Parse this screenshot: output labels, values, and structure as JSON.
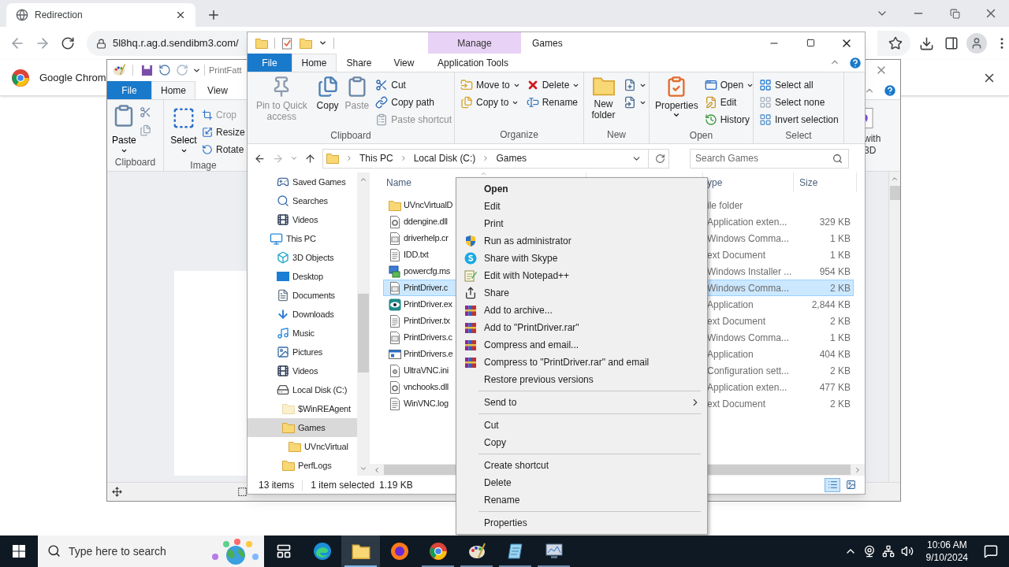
{
  "browser": {
    "tab": {
      "title": "Redirection",
      "selected": true
    },
    "url": "5l8hq.r.ag.d.sendibm3.com/",
    "infobar": "Google Chrom"
  },
  "paint": {
    "title": "PrintFatt",
    "tabs": [
      {
        "label": "File",
        "kind": "file",
        "selected": false
      },
      {
        "label": "Home",
        "kind": "tab",
        "selected": true
      },
      {
        "label": "View",
        "kind": "tab",
        "selected": false
      }
    ],
    "clipboard": {
      "label": "Clipboard",
      "paste": "Paste"
    },
    "image": {
      "label": "Image",
      "select": "Select",
      "tools": [
        {
          "label": "Crop",
          "disabled": true
        },
        {
          "label": "Resize",
          "disabled": false
        },
        {
          "label": "Rotate",
          "disabled": false
        }
      ]
    },
    "paint3d": [
      "with",
      "3D"
    ]
  },
  "explorer": {
    "title": "Games",
    "contextual_tab": "Manage",
    "tabs": [
      {
        "label": "File",
        "kind": "file",
        "selected": false
      },
      {
        "label": "Home",
        "kind": "tab",
        "selected": true
      },
      {
        "label": "Share",
        "kind": "tab",
        "selected": false
      },
      {
        "label": "View",
        "kind": "tab",
        "selected": false
      },
      {
        "label": "Application Tools",
        "kind": "contextual",
        "selected": false
      }
    ],
    "ribbon": [
      {
        "label": "Clipboard",
        "columns": [
          [
            {
              "label": "Pin to Quick access",
              "kind": "large",
              "dropdown": false,
              "disabled": true
            }
          ],
          [
            {
              "label": "Copy",
              "kind": "large",
              "dropdown": false,
              "disabled": false
            }
          ],
          [
            {
              "label": "Paste",
              "kind": "large",
              "dropdown": false,
              "disabled": true
            }
          ],
          [
            {
              "label": "Cut",
              "kind": "small",
              "dropdown": false,
              "disabled": false
            },
            {
              "label": "Copy path",
              "kind": "small",
              "dropdown": false,
              "disabled": false
            },
            {
              "label": "Paste shortcut",
              "kind": "small",
              "dropdown": false,
              "disabled": true
            }
          ]
        ]
      },
      {
        "label": "Organize",
        "columns": [
          [
            {
              "label": "Move to",
              "kind": "small",
              "dropdown": true,
              "disabled": false
            },
            {
              "label": "Copy to",
              "kind": "small",
              "dropdown": true,
              "disabled": false
            }
          ],
          [
            {
              "label": "Delete",
              "kind": "small",
              "dropdown": true,
              "disabled": false
            },
            {
              "label": "Rename",
              "kind": "small",
              "dropdown": false,
              "disabled": false
            }
          ]
        ]
      },
      {
        "label": "New",
        "columns": [
          [
            {
              "label": "New folder",
              "kind": "large",
              "dropdown": false,
              "disabled": false
            }
          ],
          [
            {
              "kind": "small",
              "dropdown": true,
              "disabled": false
            },
            {
              "kind": "small",
              "dropdown": true,
              "disabled": false
            }
          ]
        ]
      },
      {
        "label": "Open",
        "columns": [
          [
            {
              "label": "Properties",
              "kind": "large",
              "dropdown": true,
              "disabled": false
            }
          ],
          [
            {
              "label": "Open",
              "kind": "small",
              "dropdown": true,
              "disabled": false
            },
            {
              "label": "Edit",
              "kind": "small",
              "dropdown": false,
              "disabled": false
            },
            {
              "label": "History",
              "kind": "small",
              "dropdown": false,
              "disabled": false
            }
          ]
        ]
      },
      {
        "label": "Select",
        "columns": [
          [
            {
              "label": "Select all",
              "kind": "small",
              "dropdown": false,
              "disabled": false
            },
            {
              "label": "Select none",
              "kind": "small",
              "dropdown": false,
              "disabled": false
            },
            {
              "label": "Invert selection",
              "kind": "small",
              "dropdown": false,
              "disabled": false
            }
          ]
        ]
      }
    ],
    "address": [
      "This PC",
      "Local Disk (C:)",
      "Games"
    ],
    "search_placeholder": "Search Games",
    "nav": {
      "scrolled_group": [
        {
          "label": "Saved Games",
          "kind": "games",
          "selected": false
        },
        {
          "label": "Searches",
          "kind": "searches",
          "selected": false
        },
        {
          "label": "Videos",
          "kind": "videos",
          "selected": false
        }
      ],
      "tree": [
        {
          "label": "This PC",
          "kind": "computer",
          "selected": false,
          "children": [
            {
              "label": "3D Objects",
              "kind": "objects",
              "selected": false
            },
            {
              "label": "Desktop",
              "kind": "desktop",
              "selected": false
            },
            {
              "label": "Documents",
              "kind": "documents",
              "selected": false
            },
            {
              "label": "Downloads",
              "kind": "downloads",
              "selected": false
            },
            {
              "label": "Music",
              "kind": "music",
              "selected": false
            },
            {
              "label": "Pictures",
              "kind": "pictures",
              "selected": false
            },
            {
              "label": "Videos",
              "kind": "videos",
              "selected": false
            },
            {
              "label": "Local Disk (C:)",
              "kind": "drive",
              "selected": false,
              "children": [
                {
                  "label": "$WinREAgent",
                  "kind": "hidden",
                  "selected": false
                },
                {
                  "label": "Games",
                  "kind": "folder",
                  "selected": true,
                  "children": [
                    {
                      "label": "UVncVirtual",
                      "kind": "folder",
                      "selected": false
                    }
                  ]
                },
                {
                  "label": "PerfLogs",
                  "kind": "folder",
                  "selected": false
                }
              ]
            }
          ]
        }
      ]
    },
    "columns": [
      "Name",
      "ype",
      "Size"
    ],
    "files": [
      {
        "name": "UVncVirtualD",
        "type": "ile folder",
        "kind": "folder",
        "selected": false
      },
      {
        "name": "ddengine.dll",
        "type": "Application exten...",
        "size": "329 KB",
        "kind": "dll",
        "selected": false
      },
      {
        "name": "driverhelp.cr",
        "type": "Windows Comma...",
        "size": "1 KB",
        "kind": "cmd",
        "selected": false
      },
      {
        "name": "IDD.txt",
        "type": "ext Document",
        "size": "1 KB",
        "kind": "txt",
        "selected": false
      },
      {
        "name": "powercfg.ms",
        "type": "Windows Installer ...",
        "size": "954 KB",
        "kind": "msi",
        "selected": false
      },
      {
        "name": "PrintDriver.c",
        "type": "Windows Comma...",
        "size": "2 KB",
        "kind": "cmd",
        "selected": true
      },
      {
        "name": "PrintDriver.ex",
        "type": "Application",
        "size": "2,844 KB",
        "kind": "app",
        "selected": false
      },
      {
        "name": "PrintDriver.tx",
        "type": "ext Document",
        "size": "2 KB",
        "kind": "txt",
        "selected": false
      },
      {
        "name": "PrintDrivers.c",
        "type": "Windows Comma...",
        "size": "1 KB",
        "kind": "cmd",
        "selected": false
      },
      {
        "name": "PrintDrivers.e",
        "type": "Application",
        "size": "404 KB",
        "kind": "exe",
        "selected": false
      },
      {
        "name": "UltraVNC.ini",
        "type": "Configuration sett...",
        "size": "2 KB",
        "kind": "ini",
        "selected": false
      },
      {
        "name": "vnchooks.dll",
        "type": "Application exten...",
        "size": "477 KB",
        "kind": "dll",
        "selected": false
      },
      {
        "name": "WinVNC.log",
        "type": "ext Document",
        "size": "2 KB",
        "kind": "txt",
        "selected": false
      }
    ],
    "status": {
      "count": "13 items",
      "selection": "1 item selected",
      "size": "1.19 KB"
    }
  },
  "context_menu": [
    {
      "kind": "item",
      "label": "Open",
      "default": true
    },
    {
      "kind": "item",
      "label": "Edit",
      "default": false
    },
    {
      "kind": "item",
      "label": "Print",
      "default": false
    },
    {
      "kind": "item",
      "label": "Run as administrator",
      "default": false
    },
    {
      "kind": "item",
      "label": "Share with Skype",
      "default": false
    },
    {
      "kind": "item",
      "label": "Edit with Notepad++",
      "default": false
    },
    {
      "kind": "item",
      "label": "Share",
      "default": false
    },
    {
      "kind": "item",
      "label": "Add to archive...",
      "default": false
    },
    {
      "kind": "item",
      "label": "Add to \"PrintDriver.rar\"",
      "default": false
    },
    {
      "kind": "item",
      "label": "Compress and email...",
      "default": false
    },
    {
      "kind": "item",
      "label": "Compress to \"PrintDriver.rar\" and email",
      "default": false
    },
    {
      "kind": "item",
      "label": "Restore previous versions",
      "default": false
    },
    {
      "kind": "separator"
    },
    {
      "kind": "submenu",
      "label": "Send to",
      "default": false
    },
    {
      "kind": "separator"
    },
    {
      "kind": "item",
      "label": "Cut",
      "default": false
    },
    {
      "kind": "item",
      "label": "Copy",
      "default": false
    },
    {
      "kind": "separator"
    },
    {
      "kind": "item",
      "label": "Create shortcut",
      "default": false
    },
    {
      "kind": "item",
      "label": "Delete",
      "default": false
    },
    {
      "kind": "item",
      "label": "Rename",
      "default": false
    },
    {
      "kind": "separator"
    },
    {
      "kind": "item",
      "label": "Properties",
      "default": false
    }
  ],
  "taskbar": {
    "search_placeholder": "Type here to search",
    "apps": [
      {
        "kind": "taskview",
        "running": false,
        "selected": false
      },
      {
        "kind": "edge",
        "running": false,
        "selected": false
      },
      {
        "kind": "explorer",
        "running": true,
        "selected": true
      },
      {
        "kind": "firefox",
        "running": false,
        "selected": false
      },
      {
        "kind": "chrome",
        "running": true,
        "selected": false
      },
      {
        "kind": "paint",
        "running": true,
        "selected": false
      },
      {
        "kind": "notepad",
        "running": true,
        "selected": false
      },
      {
        "kind": "monitor",
        "running": true,
        "selected": false
      }
    ],
    "time": "10:06 AM",
    "date": "9/10/2024"
  }
}
